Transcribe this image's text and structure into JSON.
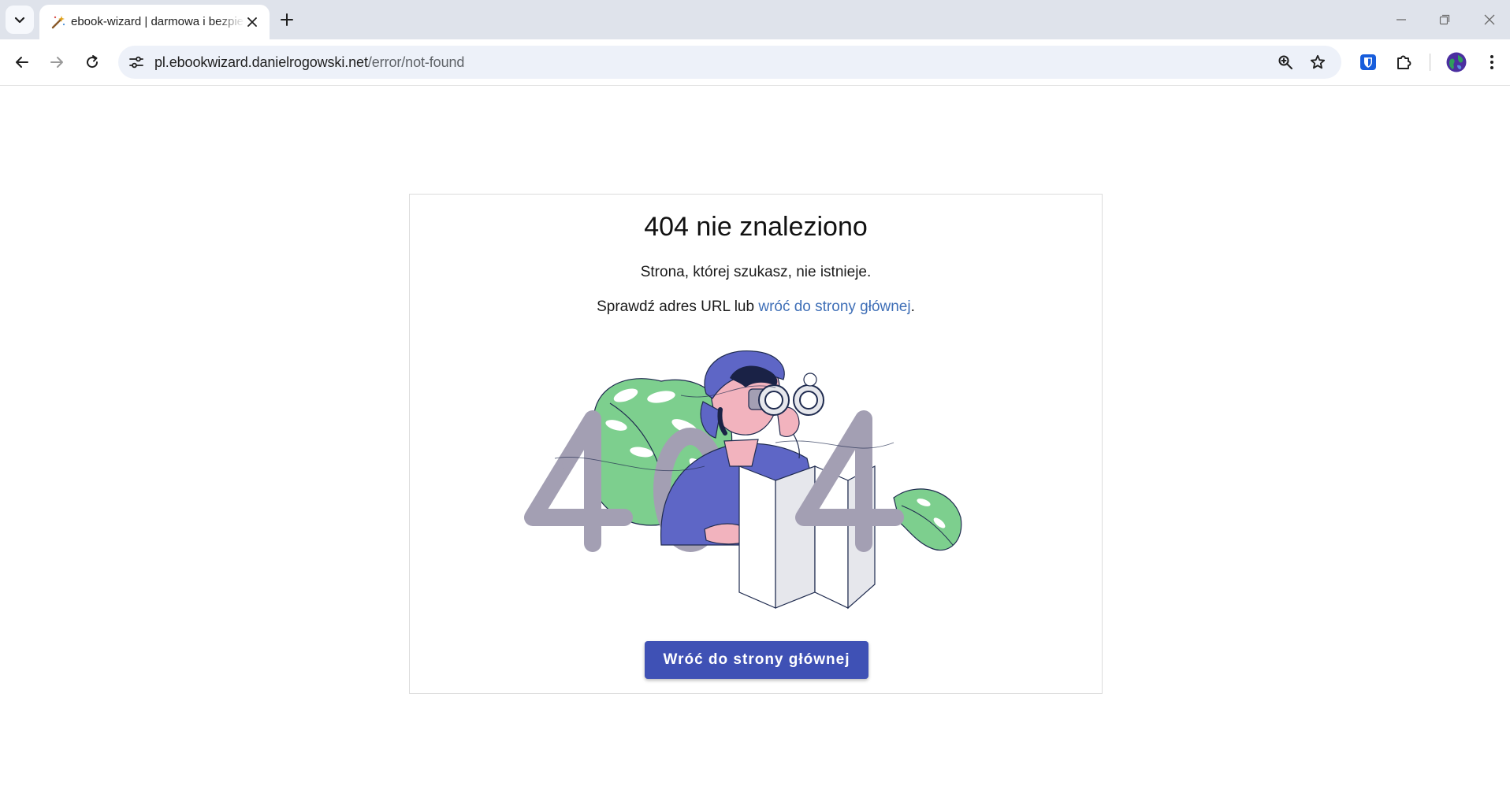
{
  "browser": {
    "tab_title": "ebook-wizard | darmowa i bezpieczna konwersja ebooków",
    "url_host": "pl.ebookwizard.danielrogowski.net",
    "url_path": "/error/not-found",
    "icons": [
      "tab-search-icon",
      "wand-favicon",
      "close-icon",
      "plus-icon",
      "minimize-icon",
      "restore-icon",
      "window-close-icon",
      "back-icon",
      "forward-icon",
      "reload-icon",
      "site-info-icon",
      "zoom-icon",
      "bookmark-star-icon",
      "bitwarden-icon",
      "extensions-icon",
      "profile-avatar-icon",
      "kebab-menu-icon"
    ]
  },
  "page": {
    "heading": "404 nie znaleziono",
    "line1": "Strona, której szukasz, nie istnieje.",
    "line2_prefix": "Sprawdź adres URL lub ",
    "line2_link": "wróć do strony głównej",
    "line2_suffix": ".",
    "button_label": "Wróć do strony głównej"
  },
  "colors": {
    "button": "#3f51b5",
    "link": "#3f6fb7",
    "illustration_blue": "#5e66c6",
    "illustration_gray": "#a39fb3",
    "illustration_green": "#7dcf8e",
    "illustration_pink": "#f2b3be"
  }
}
